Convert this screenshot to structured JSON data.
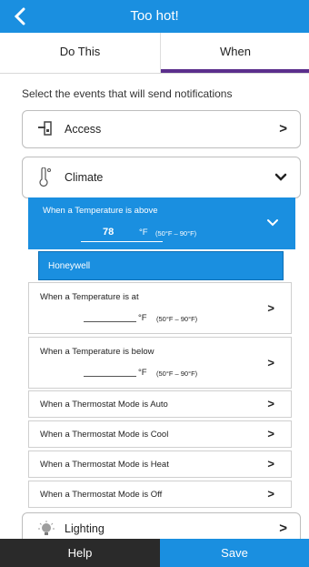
{
  "header": {
    "title": "Too hot!",
    "back_icon": "chevron-left-icon"
  },
  "tabs": {
    "do_this": "Do This",
    "when": "When"
  },
  "intro": "Select the events that will send notifications",
  "groups": {
    "access": {
      "label": "Access",
      "icon": "lock-icon"
    },
    "climate": {
      "label": "Climate",
      "icon": "thermometer-icon"
    },
    "lighting": {
      "label": "Lighting",
      "icon": "bulb-icon"
    }
  },
  "temp_above": {
    "label": "When a Temperature is above",
    "value": "78",
    "unit": "°F",
    "range": "(50°F – 90°F)"
  },
  "device": "Honeywell",
  "temp_at": {
    "label": "When a Temperature is at",
    "unit": "°F",
    "range": "(50°F – 90°F)"
  },
  "temp_below": {
    "label": "When a Temperature is below",
    "unit": "°F",
    "range": "(50°F – 90°F)"
  },
  "thermostat_modes": [
    "When a Thermostat Mode is Auto",
    "When a Thermostat Mode is Cool",
    "When a Thermostat Mode is Heat",
    "When a Thermostat Mode is Off"
  ],
  "footer": {
    "help": "Help",
    "save": "Save"
  },
  "colors": {
    "primary": "#1a8fe0",
    "tab_indicator": "#5b2e8c",
    "footer_dark": "#2a2a2a"
  }
}
